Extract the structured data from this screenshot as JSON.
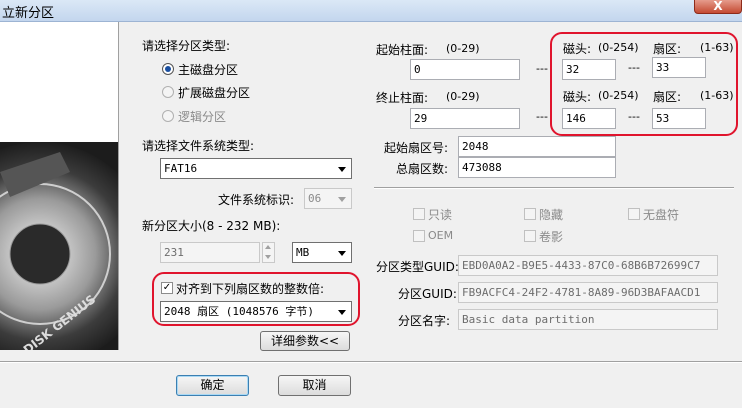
{
  "window": {
    "title": "立新分区",
    "close_label": "X"
  },
  "sidebar": {
    "logo_text": "DISK GENIUS"
  },
  "partition_type": {
    "heading": "请选择分区类型:",
    "options": [
      {
        "label": "主磁盘分区",
        "selected": true,
        "enabled": true
      },
      {
        "label": "扩展磁盘分区",
        "selected": false,
        "enabled": false
      },
      {
        "label": "逻辑分区",
        "selected": false,
        "enabled": false
      }
    ]
  },
  "filesystem": {
    "heading": "请选择文件系统类型:",
    "value": "FAT16",
    "id_label": "文件系统标识:",
    "id_value": "06"
  },
  "size": {
    "label": "新分区大小(8 - 232 MB):",
    "value": "231",
    "unit": "MB"
  },
  "align": {
    "checkbox_label": "对齐到下列扇区数的整数倍:",
    "checked": true,
    "value": "2048 扇区 (1048576 字节)"
  },
  "details_button": "详细参数<<",
  "geometry": {
    "start_cyl_label": "起始柱面:",
    "start_cyl_range": "(0-29)",
    "start_cyl_value": "0",
    "end_cyl_label": "终止柱面:",
    "end_cyl_range": "(0-29)",
    "end_cyl_value": "29",
    "head_label": "磁头:",
    "head_range": "(0-254)",
    "sector_label": "扇区:",
    "sector_range": "(1-63)",
    "start_head": "32",
    "start_sector": "33",
    "end_head": "146",
    "end_sector": "53",
    "dash": "---"
  },
  "sectors": {
    "start_label": "起始扇区号:",
    "start_value": "2048",
    "total_label": "总扇区数:",
    "total_value": "473088"
  },
  "attributes": {
    "readonly": "只读",
    "hidden": "隐藏",
    "no_drive_letter": "无盘符",
    "oem": "OEM",
    "shadow": "卷影"
  },
  "guid": {
    "type_label": "分区类型GUID:",
    "type_value": "EBD0A0A2-B9E5-4433-87C0-68B6B72699C7",
    "part_label": "分区GUID:",
    "part_value": "FB9ACFC4-24F2-4781-8A89-96D3BAFAACD1",
    "name_label": "分区名字:",
    "name_value": "Basic data partition"
  },
  "buttons": {
    "ok": "确定",
    "cancel": "取消"
  },
  "colors": {
    "highlight": "#e0142d",
    "radio_accent": "#1a4fa0"
  }
}
